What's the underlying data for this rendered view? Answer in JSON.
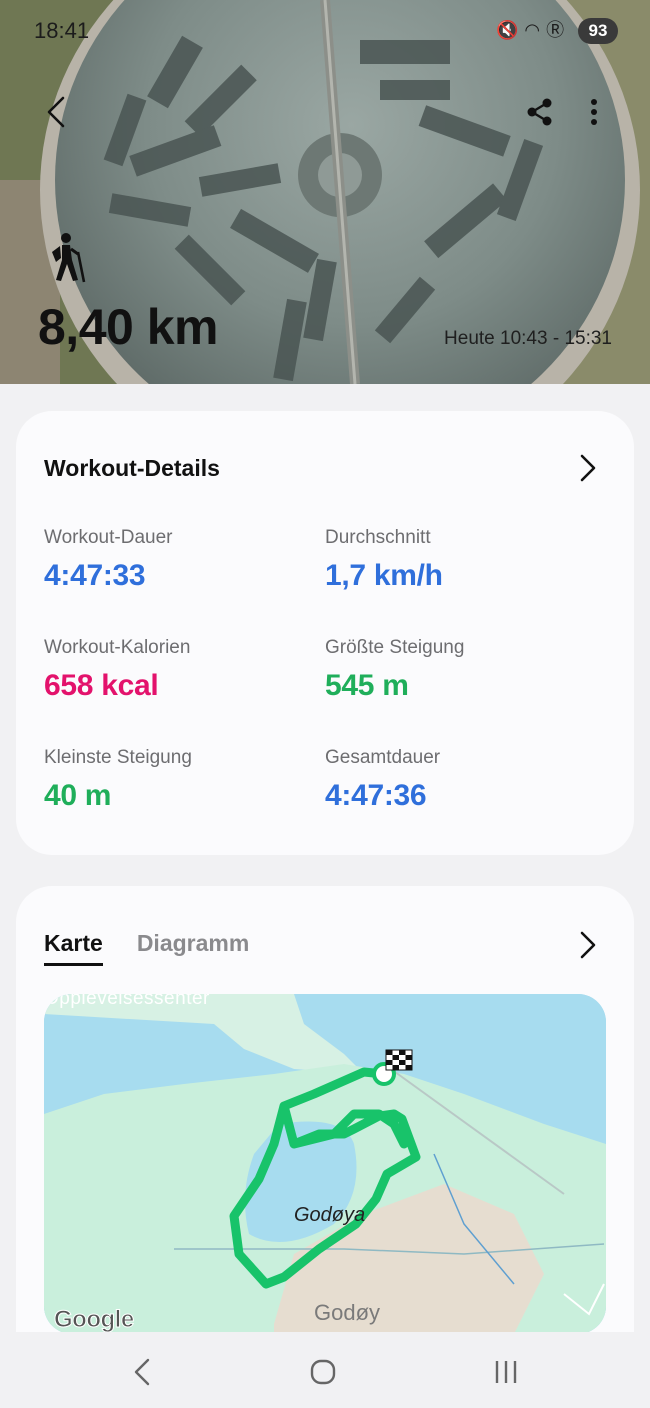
{
  "status_bar": {
    "time": "18:41",
    "icons": [
      "mute-icon",
      "wifi-icon",
      "r-icon"
    ],
    "battery": "93"
  },
  "hero": {
    "distance": "8,40 km",
    "time_range": "Heute 10:43 - 15:31",
    "activity_icon": "hiking-icon"
  },
  "details": {
    "title": "Workout-Details",
    "stats": [
      {
        "label": "Workout-Dauer",
        "value": "4:47:33",
        "color": "#2f6fdb"
      },
      {
        "label": "Durchschnitt",
        "value": "1,7 km/h",
        "color": "#2f6fdb"
      },
      {
        "label": "Workout-Kalorien",
        "value": "658 kcal",
        "color": "#e3126c"
      },
      {
        "label": "Größte Steigung",
        "value": "545 m",
        "color": "#1fae5a"
      },
      {
        "label": "Kleinste Steigung",
        "value": "40 m",
        "color": "#1fae5a"
      },
      {
        "label": "Gesamtdauer",
        "value": "4:47:36",
        "color": "#2f6fdb"
      }
    ]
  },
  "map_section": {
    "tabs": [
      {
        "label": "Karte",
        "active": true
      },
      {
        "label": "Diagramm",
        "active": false
      }
    ],
    "place_top": "Opplevelsessenter",
    "place_main": "Godøya",
    "place_bottom": "Godøy",
    "attribution": "Google"
  },
  "colors": {
    "route": "#18c36a",
    "water": "#a7dcef",
    "land": "#c9efdc"
  }
}
